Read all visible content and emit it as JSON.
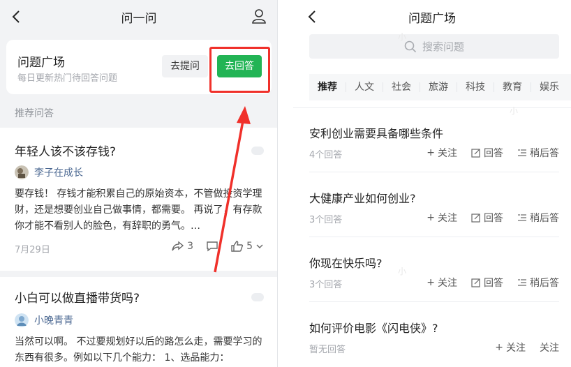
{
  "left": {
    "header": {
      "title": "问一问"
    },
    "qa_card": {
      "title": "问题广场",
      "subtitle": "每日更新热门待回答问题",
      "ask_label": "去提问",
      "answer_label": "去回答"
    },
    "section_label": "推荐问答",
    "posts": [
      {
        "title": "年轻人该不该存钱?",
        "author": "李子在成长",
        "body": "要存钱！ 存钱才能积累自己的原始资本，不管做投资学理财，还是想要创业自己做事情，都需要。 再说了，有存款你才能不看别人的脸色，有辞职的勇气。…",
        "date": "7月29日",
        "shares": "3",
        "likes": "5"
      },
      {
        "title": "小白可以做直播带货吗?",
        "author": "小晚青青",
        "body": "当然可以啊。 不过要规划好以后的路怎么走，需要学习的东西有很多。例如以下几个能力： 1、选品能力："
      }
    ]
  },
  "right": {
    "header": {
      "title": "问题广场"
    },
    "search": {
      "placeholder": "搜索问题"
    },
    "tabs": [
      "推荐",
      "人文",
      "社会",
      "旅游",
      "科技",
      "教育",
      "娱乐"
    ],
    "questions": [
      {
        "title": "安利创业需要具备哪些条件",
        "count": "4个回答",
        "follow": "关注",
        "answer": "回答",
        "later": "稍后答"
      },
      {
        "title": "大健康产业如何创业?",
        "count": "3个回答",
        "follow": "关注",
        "answer": "回答",
        "later": "稍后答"
      },
      {
        "title": "你现在快乐吗?",
        "count": "3个回答",
        "follow": "关注",
        "answer": "回答",
        "later": "稍后答"
      },
      {
        "title": "如何评价电影《闪电侠》?",
        "count": "暂无回答",
        "follow": "关注",
        "answer": "关注"
      }
    ]
  },
  "watermark": "小",
  "colors": {
    "accent_green": "#22b455",
    "highlight_red": "#f0302a",
    "link_blue": "#4a6791"
  }
}
